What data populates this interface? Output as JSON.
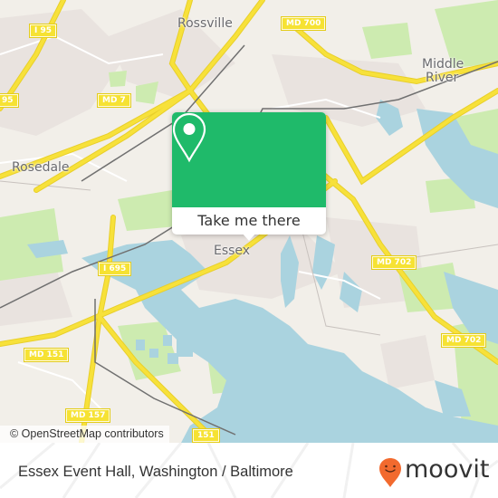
{
  "map": {
    "attribution": "© OpenStreetMap contributors",
    "places": {
      "rossville": "Rossville",
      "middle_river_1": "Middle",
      "middle_river_2": "River",
      "rosedale": "Rosedale",
      "essex": "Essex"
    },
    "road_shields": {
      "i95_top": "I 95",
      "i95_left": "95",
      "md7": "MD 7",
      "md700": "MD 700",
      "i695": "I 695",
      "md702_upper": "MD 702",
      "md702_lower": "MD 702",
      "md151_left": "MD 151",
      "md151_bottom": "151",
      "md157": "MD 157"
    },
    "colors": {
      "land": "#f2efe9",
      "water": "#aad3df",
      "park": "#cdebb0",
      "road": "#f7e13a",
      "rail": "#707070"
    }
  },
  "popup": {
    "button_label": "Take me there",
    "icon": "map-pin-icon",
    "color": "#1fba6a"
  },
  "footer": {
    "title": "Essex Event Hall, Washington / Baltimore",
    "logo_text": "moovit",
    "logo_icon": "moovit-pin-icon",
    "logo_color": "#f26a2e"
  }
}
